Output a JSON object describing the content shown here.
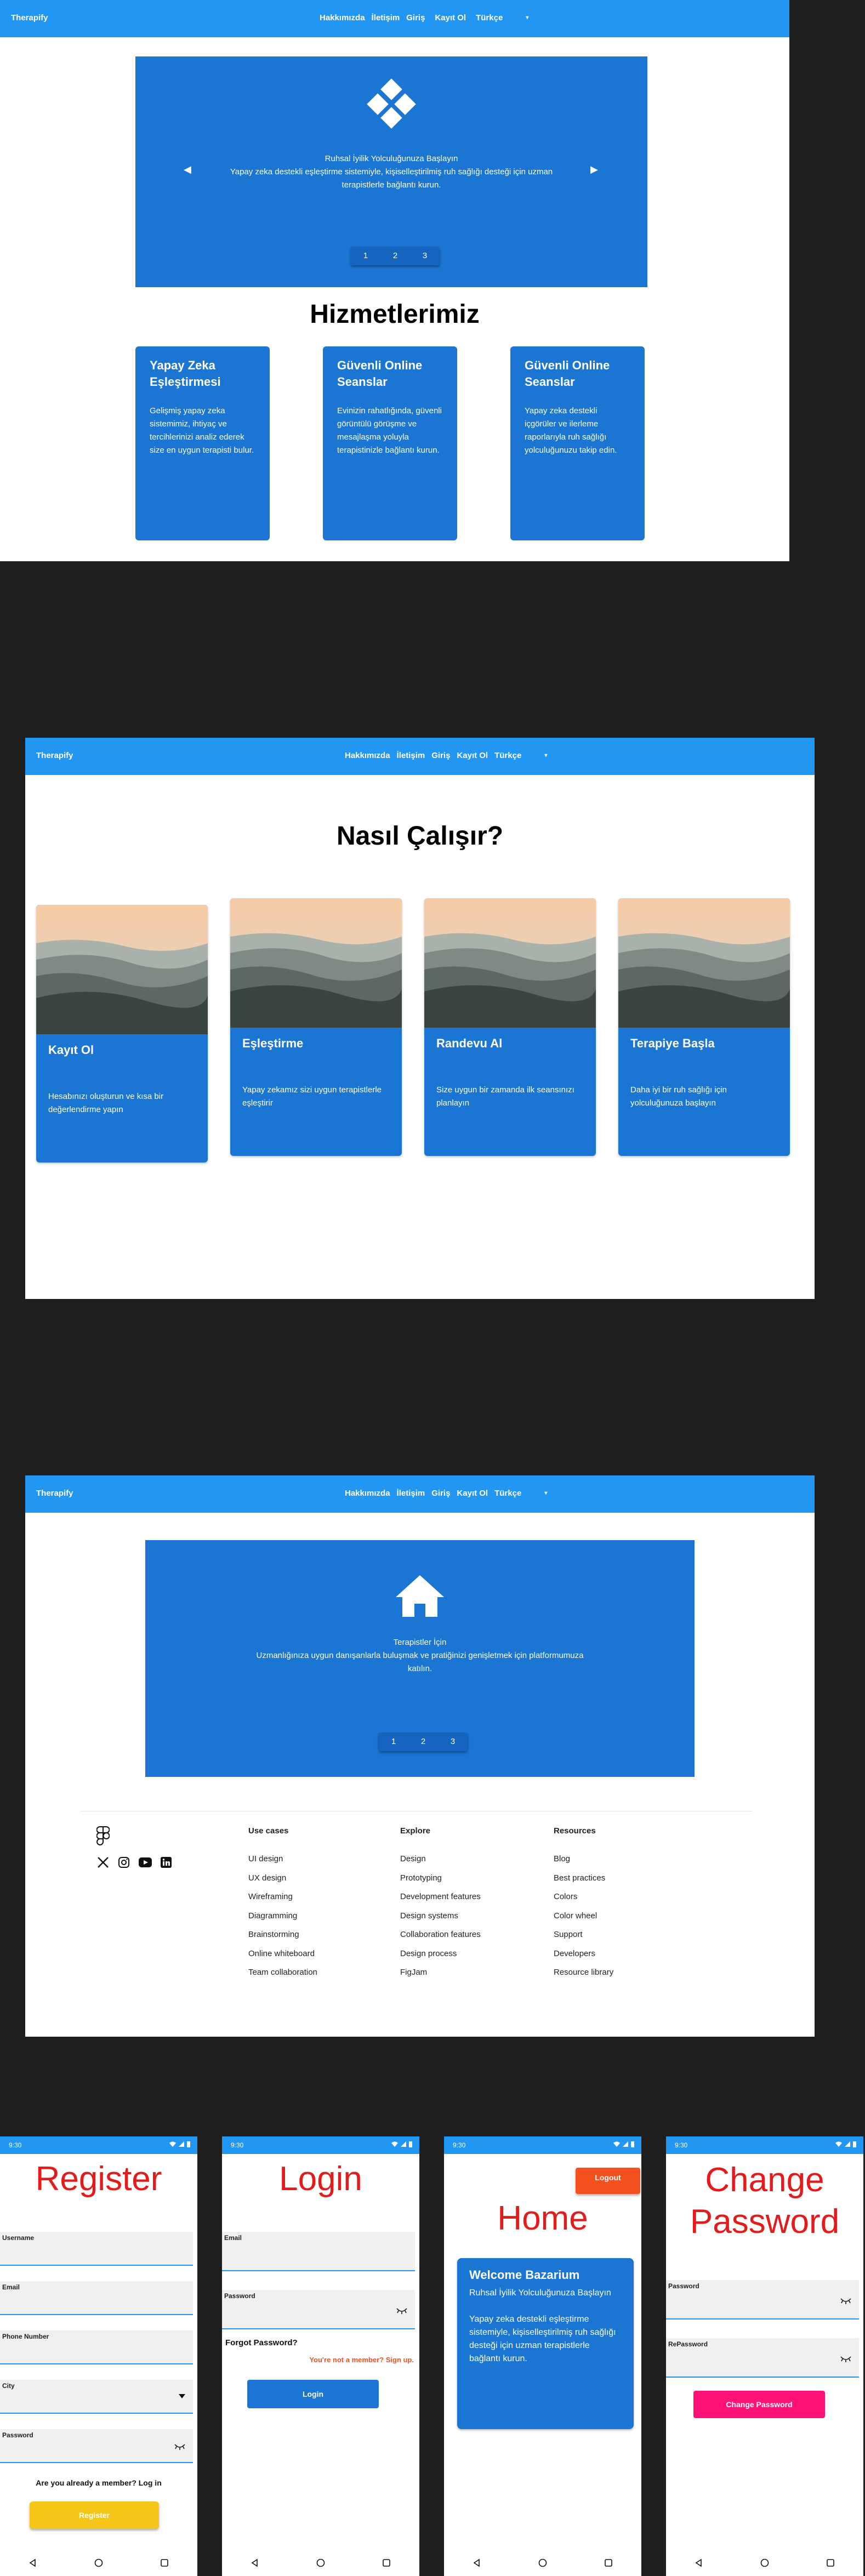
{
  "nav": {
    "brand": "Therapify",
    "links": [
      "Hakkımızda",
      "İletişim",
      "Giriş",
      "Kayıt Ol",
      "Türkçe"
    ],
    "caret": "▾"
  },
  "screen1": {
    "carousel": {
      "title": "Ruhsal İyilik Yolculuğunuza Başlayın",
      "line1": "Yapay zeka destekli eşleştirme sistemiyle, kişiselleştirilmiş ruh sağlığı desteği için uzman",
      "line2": "terapistlerle bağlantı kurun.",
      "prev": "◀",
      "next": "▶",
      "dots": [
        "1",
        "2",
        "3"
      ]
    },
    "heading": "Hizmetlerimiz",
    "services": [
      {
        "title": "Yapay Zeka Eşleştirmesi",
        "text": "Gelişmiş yapay zeka sistemimiz, ihtiyaç ve tercihlerinizi analiz ederek size en uygun terapisti bulur."
      },
      {
        "title": "Güvenli Online Seanslar",
        "text": "Evinizin rahatlığında, güvenli görüntülü görüşme ve mesajlaşma yoluyla terapistinizle bağlantı kurun."
      },
      {
        "title": "Güvenli Online Seanslar",
        "text": "Yapay zeka destekli içgörüler ve ilerleme raporlarıyla ruh sağlığı yolculuğunuzu takip edin."
      }
    ]
  },
  "screen2": {
    "heading": "Nasıl Çalışır?",
    "steps": [
      {
        "title": "Kayıt Ol",
        "text": "Hesabınızı oluşturun ve kısa bir değerlendirme yapın"
      },
      {
        "title": "Eşleştirme",
        "text": "Yapay zekamız sizi uygun terapistlerle eşleştirir"
      },
      {
        "title": "Randevu Al",
        "text": "Size uygun bir zamanda ilk seansınızı planlayın"
      },
      {
        "title": "Terapiye Başla",
        "text": "Daha iyi bir ruh sağlığı için yolculuğunuza başlayın"
      }
    ]
  },
  "screen3": {
    "carousel": {
      "title": "Terapistler İçin",
      "line1": "Uzmanlığınıza uygun danışanlarla buluşmak ve pratiğinizi genişletmek için platformumuza",
      "line2": "katılın.",
      "dots": [
        "1",
        "2",
        "3"
      ]
    },
    "footer": {
      "columns": [
        {
          "title": "Use cases",
          "items": [
            "UI design",
            "UX design",
            "Wireframing",
            "Diagramming",
            "Brainstorming",
            "Online whiteboard",
            "Team collaboration"
          ]
        },
        {
          "title": "Explore",
          "items": [
            "Design",
            "Prototyping",
            "Development features",
            "Design systems",
            "Collaboration features",
            "Design process",
            "FigJam"
          ]
        },
        {
          "title": "Resources",
          "items": [
            "Blog",
            "Best practices",
            "Colors",
            "Color wheel",
            "Support",
            "Developers",
            "Resource library"
          ]
        }
      ]
    }
  },
  "mobile": {
    "time": "9:30",
    "register": {
      "title": "Register",
      "fields": [
        "Username",
        "Email",
        "Phone Number",
        "City",
        "Password"
      ],
      "member_text": "Are you already a member? Log in",
      "button": "Register"
    },
    "login": {
      "title": "Login",
      "fields": [
        "Email",
        "Password"
      ],
      "forgot": "Forgot Password?",
      "signup": "You're not a member? Sign up.",
      "button": "Login"
    },
    "home": {
      "logout": "Logout",
      "title": "Home",
      "card_title": "Welcome Bazarium",
      "card_sub": "Ruhsal İyilik Yolculuğunuza Başlayın",
      "card_text": "Yapay zeka destekli eşleştirme sistemiyle, kişiselleştirilmiş ruh sağlığı desteği için uzman terapistlerle bağlantı kurun."
    },
    "change": {
      "title": "Change Password",
      "fields": [
        "Password",
        "RePassword"
      ],
      "button": "Change Password"
    }
  },
  "colors": {
    "primary": "#2196f3",
    "card": "#1a76d2",
    "title_red": "#e41b1b",
    "logout": "#f4511e",
    "register_btn": "#f5c518",
    "change_btn": "#ff1177"
  }
}
